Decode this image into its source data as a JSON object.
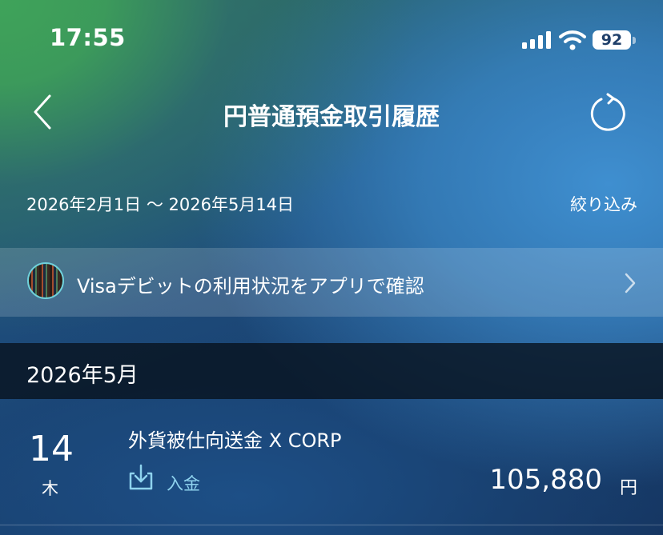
{
  "status_bar": {
    "time": "17:55",
    "battery": "92"
  },
  "nav": {
    "title": "円普通預金取引履歴"
  },
  "period": {
    "range": "2026年2月1日 〜 2026年5月14日",
    "filter_label": "絞り込み"
  },
  "banner": {
    "text": "Visaデビットの利用状況をアプリで確認"
  },
  "month_section": {
    "label": "2026年5月"
  },
  "transactions": [
    {
      "day": "14",
      "weekday": "木",
      "description": "外貨被仕向送金 X CORP",
      "type": "入金",
      "amount": "105,880",
      "currency": "円"
    }
  ],
  "colors": {
    "accent_type": "#8fd3ee",
    "month_bar": "#08141f",
    "logo_ring": "#6fd2dc"
  },
  "icons": [
    "back-chevron-icon",
    "refresh-icon",
    "signal-icon",
    "wifi-icon",
    "battery-icon",
    "chevron-right-icon",
    "deposit-download-icon"
  ]
}
